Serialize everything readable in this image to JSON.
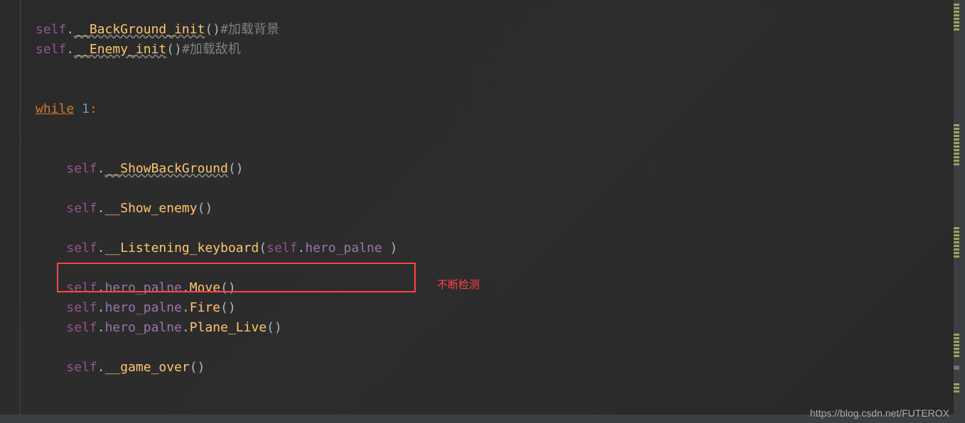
{
  "code": {
    "line1": {
      "self": "self",
      "dot": ".",
      "method": "__BackGround_init",
      "parens": "()",
      "comment": "#加载背景"
    },
    "line2": {
      "self": "self",
      "dot": ".",
      "method": "__Enemy_init",
      "parens": "()",
      "comment": "#加载敌机"
    },
    "line3": {
      "keyword": "while",
      "space": " ",
      "number": "1",
      "colon": ":"
    },
    "line4": {
      "self": "self",
      "dot": ".",
      "method": "__ShowBackGround",
      "parens": "()"
    },
    "line5": {
      "self": "self",
      "dot": ".",
      "method": "__Show_enemy",
      "parens": "()"
    },
    "line6": {
      "self": "self",
      "dot": ".",
      "method": "__Listening_keyboard",
      "open": "(",
      "arg_self": "self",
      "arg_dot": ".",
      "arg_attr": "hero_palne",
      "close": ")"
    },
    "line7": {
      "self": "self",
      "dot": ".",
      "attr": "hero_palne",
      "dot2": ".",
      "method": "Move",
      "parens": "()"
    },
    "line8": {
      "self": "self",
      "dot": ".",
      "attr": "hero_palne",
      "dot2": ".",
      "method": "Fire",
      "parens": "()"
    },
    "line9": {
      "self": "self",
      "dot": ".",
      "attr": "hero_palne",
      "dot2": ".",
      "method": "Plane_Live",
      "parens": "()"
    },
    "line10": {
      "self": "self",
      "dot": ".",
      "method": "__game_over",
      "parens": "()"
    }
  },
  "annotation": {
    "text": "不断检测"
  },
  "watermark": {
    "text": "https://blog.csdn.net/FUTEROX"
  }
}
